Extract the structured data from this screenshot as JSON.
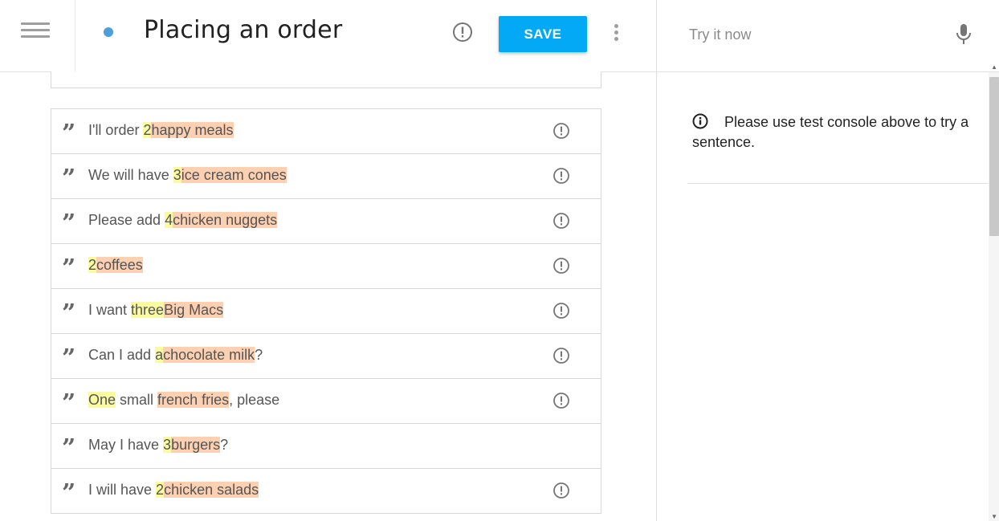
{
  "header": {
    "title": "Placing an order",
    "save_label": "SAVE",
    "status_dot_color": "#4a9fdc",
    "accent_color": "#03a9f4"
  },
  "console": {
    "placeholder": "Try it now",
    "info_message": "Please use test console above to try a sentence."
  },
  "highlight_colors": {
    "number": "#fafaa0",
    "product": "#fcd0b0"
  },
  "examples": [
    {
      "warning": true,
      "parts": [
        {
          "text": "I'll order "
        },
        {
          "text": "2",
          "entity": "number"
        },
        {
          "text": "happy meals",
          "entity": "product"
        }
      ]
    },
    {
      "warning": true,
      "parts": [
        {
          "text": "We will have "
        },
        {
          "text": "3",
          "entity": "number"
        },
        {
          "text": "ice cream cones",
          "entity": "product"
        }
      ]
    },
    {
      "warning": true,
      "parts": [
        {
          "text": "Please add "
        },
        {
          "text": "4",
          "entity": "number"
        },
        {
          "text": "chicken nuggets",
          "entity": "product"
        }
      ]
    },
    {
      "warning": true,
      "parts": [
        {
          "text": "2",
          "entity": "number"
        },
        {
          "text": "coffees",
          "entity": "product"
        }
      ]
    },
    {
      "warning": true,
      "parts": [
        {
          "text": "I want "
        },
        {
          "text": "three",
          "entity": "number"
        },
        {
          "text": "Big Macs",
          "entity": "product"
        }
      ]
    },
    {
      "warning": true,
      "parts": [
        {
          "text": "Can I add "
        },
        {
          "text": "a",
          "entity": "number"
        },
        {
          "text": "chocolate milk",
          "entity": "product"
        },
        {
          "text": "?"
        }
      ]
    },
    {
      "warning": true,
      "parts": [
        {
          "text": "One",
          "entity": "number"
        },
        {
          "text": " small "
        },
        {
          "text": "french fries",
          "entity": "product"
        },
        {
          "text": ", please"
        }
      ]
    },
    {
      "warning": false,
      "parts": [
        {
          "text": "May I have "
        },
        {
          "text": "3",
          "entity": "number"
        },
        {
          "text": "burgers",
          "entity": "product"
        },
        {
          "text": "?"
        }
      ]
    },
    {
      "warning": true,
      "parts": [
        {
          "text": "I will have "
        },
        {
          "text": "2",
          "entity": "number"
        },
        {
          "text": "chicken salads",
          "entity": "product"
        }
      ]
    }
  ]
}
